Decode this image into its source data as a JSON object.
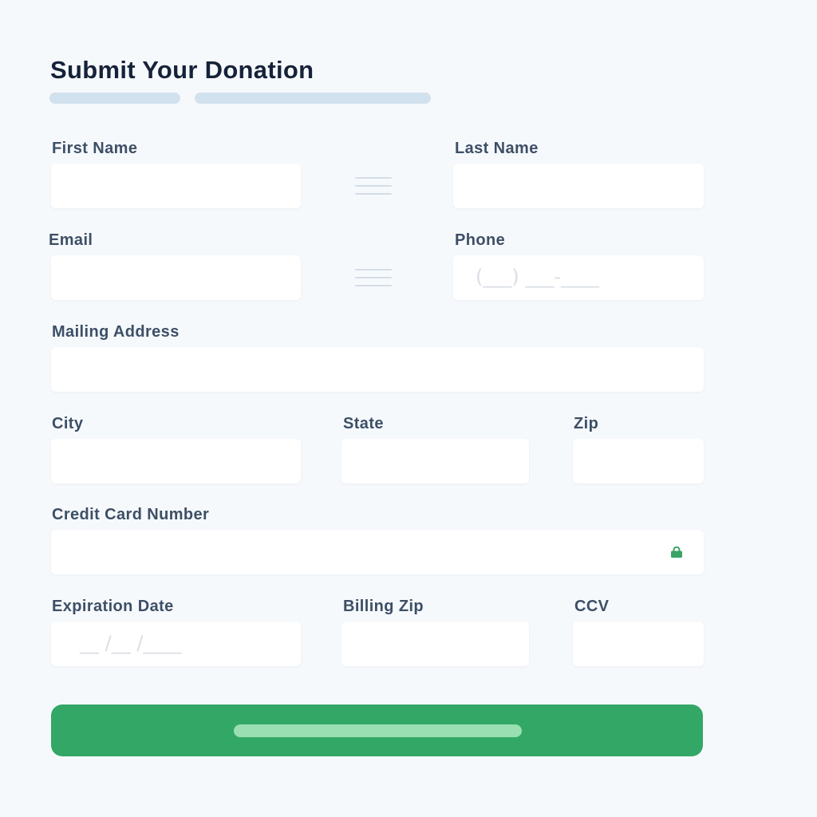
{
  "form": {
    "title": "Submit Your Donation",
    "fields": {
      "first_name": {
        "label": "First Name",
        "value": ""
      },
      "last_name": {
        "label": "Last Name",
        "value": ""
      },
      "email": {
        "label": "Email",
        "value": ""
      },
      "phone": {
        "label": "Phone",
        "placeholder": "(___) ___-____"
      },
      "mailing_address": {
        "label": "Mailing Address",
        "value": ""
      },
      "city": {
        "label": "City",
        "value": ""
      },
      "state": {
        "label": "State",
        "value": ""
      },
      "zip": {
        "label": "Zip",
        "value": ""
      },
      "credit_card_number": {
        "label": "Credit Card Number",
        "value": "",
        "icon": "lock-icon"
      },
      "expiration_date": {
        "label": "Expiration Date",
        "placeholder": "__ /__ /____"
      },
      "billing_zip": {
        "label": "Billing Zip",
        "value": ""
      },
      "ccv": {
        "label": "CCV",
        "value": ""
      }
    },
    "colors": {
      "background": "#f6f9fc",
      "accent_green": "#33a866",
      "button_pill": "#99dfb1",
      "placeholder_bar": "#d2e1ee",
      "lock_icon": "#3aa265"
    }
  }
}
